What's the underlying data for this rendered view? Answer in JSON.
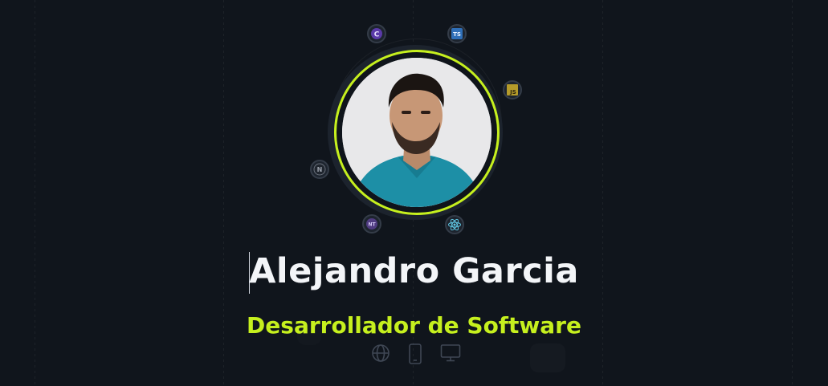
{
  "profile": {
    "name": "Alejandro Garcia",
    "role": "Desarrollador de Software",
    "avatar_alt": "profile-photo"
  },
  "tech_badges": [
    {
      "name": "csharp-icon",
      "label": "C"
    },
    {
      "name": "typescript-icon",
      "label": "TS"
    },
    {
      "name": "javascript-icon",
      "label": "JS"
    },
    {
      "name": "nextjs-icon",
      "label": "N"
    },
    {
      "name": "nuxt-icon",
      "label": "NT"
    },
    {
      "name": "react-icon",
      "label": ""
    }
  ],
  "platforms": [
    {
      "name": "globe-icon"
    },
    {
      "name": "mobile-icon"
    },
    {
      "name": "desktop-icon"
    }
  ],
  "colors": {
    "background": "#10151c",
    "accent": "#c6f01e",
    "name_text": "#f3f5f8"
  }
}
